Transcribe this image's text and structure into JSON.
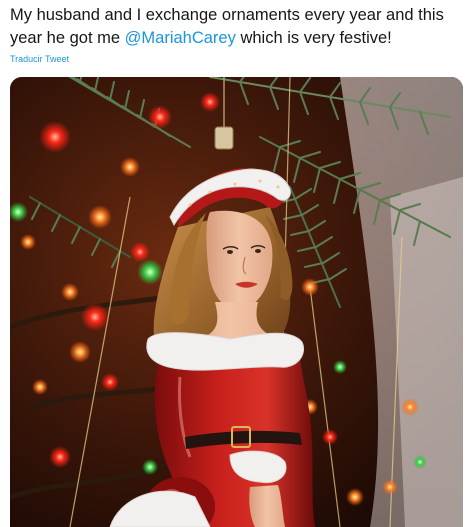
{
  "tweet": {
    "text_before": "My husband and I exchange ornaments every year and this year he got me ",
    "mention": "@MariahCarey",
    "text_after": " which is very festive!",
    "translate_label": "Traducir Tweet"
  },
  "media": {
    "colors": {
      "background": "#2a1208",
      "dress": "#b51818",
      "fur": "#f2f0ee",
      "hair": "#a7702e",
      "skin": "#e9b596",
      "needles": "#4f7048",
      "light_warm": "#ff7b2a"
    }
  }
}
